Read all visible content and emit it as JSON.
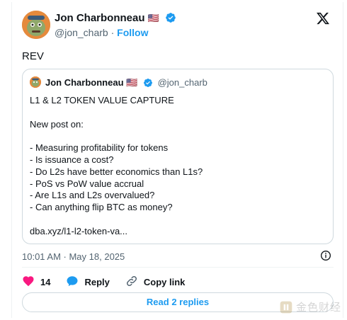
{
  "author": {
    "name": "Jon Charbonneau",
    "flag": "🇺🇸",
    "handle": "@jon_charb",
    "separator": "·",
    "follow_label": "Follow"
  },
  "tweet_text": "REV",
  "quote": {
    "name": "Jon Charbonneau",
    "flag": "🇺🇸",
    "handle": "@jon_charb",
    "lines": [
      "L1 & L2 TOKEN VALUE CAPTURE",
      "",
      "New post on:",
      "",
      "- Measuring profitability for tokens",
      "- Is issuance a cost?",
      "- Do L2s have better economics than L1s?",
      "- PoS vs PoW value accrual",
      "- Are L1s and L2s overvalued?",
      "- Can anything flip BTC as money?",
      "",
      "dba.xyz/l1-l2-token-va..."
    ]
  },
  "timestamp": "10:01 AM · May 18, 2025",
  "actions": {
    "likes_count": "14",
    "reply_label": "Reply",
    "copy_link_label": "Copy link"
  },
  "read_replies_label": "Read 2 replies",
  "watermark_text": "金色财经",
  "colors": {
    "accent": "#1d9bf0",
    "like": "#f91880",
    "text": "#0f1419",
    "muted": "#536471",
    "border": "#cfd9de"
  },
  "icons": [
    "x-logo-icon",
    "verified-badge-icon",
    "info-icon",
    "heart-icon",
    "reply-bubble-icon",
    "link-icon"
  ]
}
